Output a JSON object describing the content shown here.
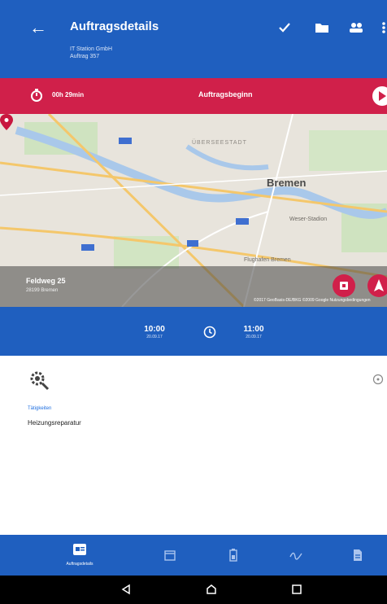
{
  "header": {
    "title": "Auftragsdetails",
    "subtitle_company": "IT Station GmbH",
    "subtitle_order": "Auftrag 357"
  },
  "actions": [
    "check-icon",
    "folder-icon",
    "people-icon",
    "more-icon"
  ],
  "timer_bar": {
    "elapsed": "00h 29min",
    "title": "Auftragsbeginn",
    "color": "#d0204a"
  },
  "map": {
    "city_label": "Bremen",
    "district_label": "ÜBERSEESTADT",
    "district_label_2": "Weser-Stadion",
    "district_label_3": "Flughafen Bremen",
    "address_line1": "Feldweg 25",
    "address_line2": "28199 Bremen",
    "copyright": "©2017 GeoBasis-DE/BKG ©2009 Google Nutzungsbedingungen"
  },
  "schedule": {
    "start_time": "10:00",
    "start_date": "20.09.17",
    "end_time": "11:00",
    "end_date": "20.09.17"
  },
  "activities": {
    "label": "Tätigkeiten",
    "value": "Heizungsreparatur"
  },
  "bottom_nav": {
    "active_label": "Auftragsdetails",
    "items": [
      "card-icon",
      "calendar-icon",
      "battery-icon",
      "signature-icon",
      "document-icon"
    ]
  },
  "colors": {
    "primary": "#1f5fbf",
    "accent": "#d0204a"
  }
}
